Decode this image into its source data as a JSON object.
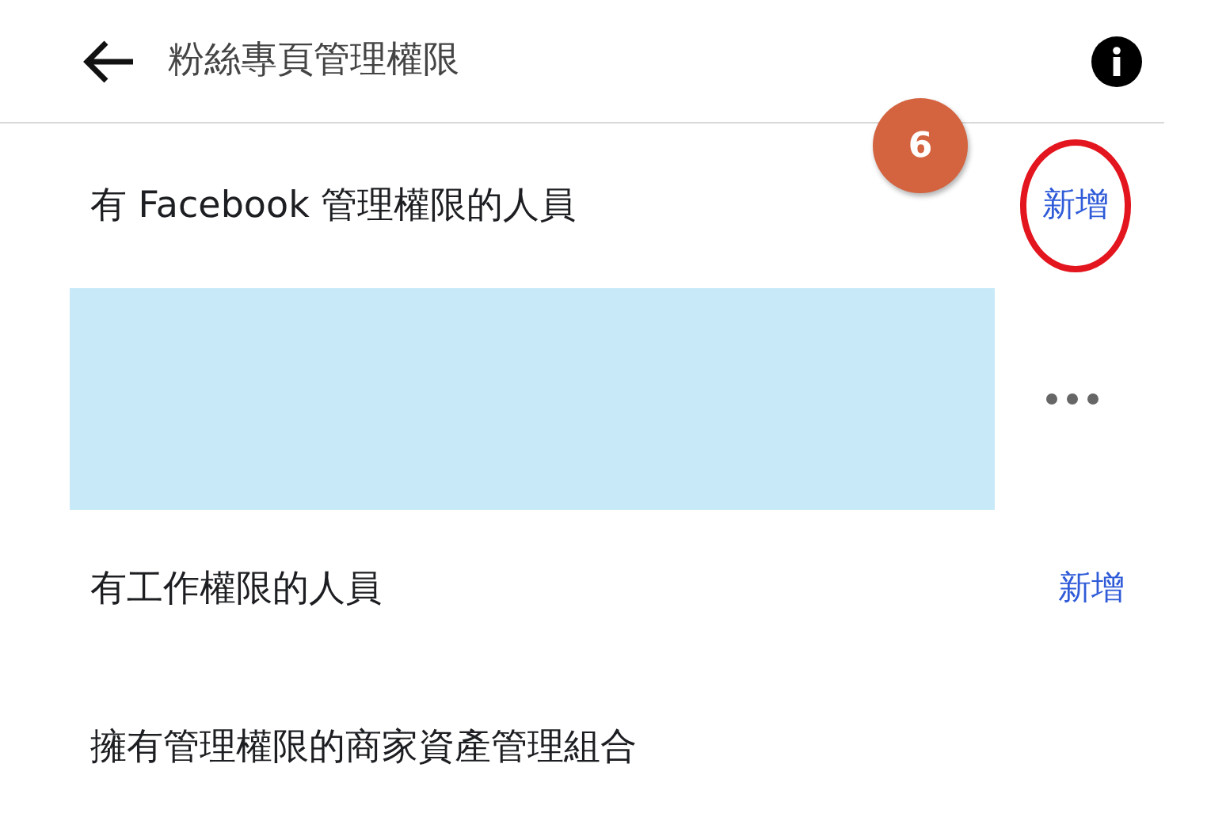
{
  "header": {
    "title": "粉絲專頁管理權限"
  },
  "rows": [
    {
      "kind": "section",
      "label": "有 Facebook 管理權限的人員",
      "action": "新增",
      "step_badge": "6",
      "circled": true
    },
    {
      "kind": "redacted"
    },
    {
      "kind": "section",
      "label": "有工作權限的人員",
      "action": "新增",
      "circled": false
    },
    {
      "kind": "section",
      "label": "擁有管理權限的商家資產管理組合"
    }
  ]
}
